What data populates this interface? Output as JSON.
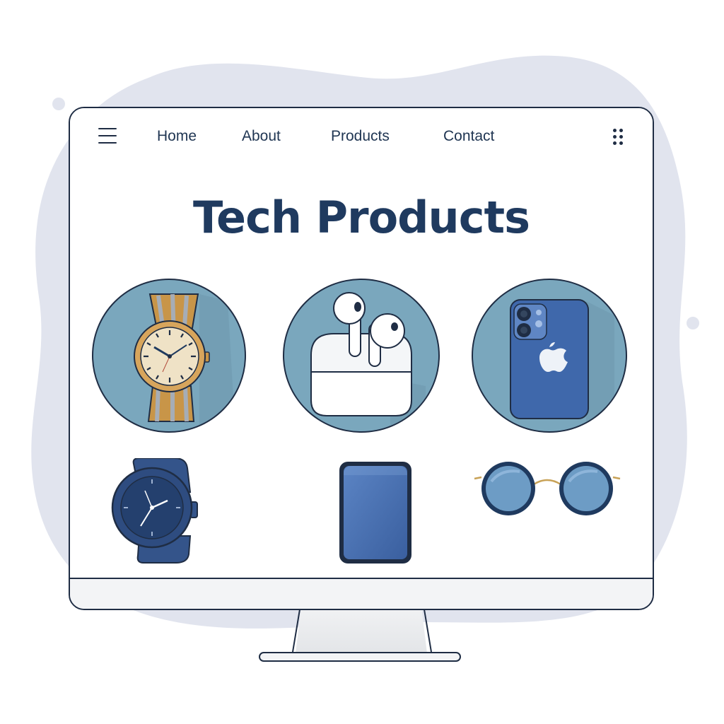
{
  "nav": {
    "menu_icon": "hamburger-menu-icon",
    "links": [
      "Home",
      "About",
      "Products",
      "Contact"
    ],
    "apps_icon": "grid-dots-icon"
  },
  "hero": {
    "title": "Tech Products"
  },
  "products": [
    {
      "icon": "gold-wristwatch-icon"
    },
    {
      "icon": "wireless-earbuds-icon"
    },
    {
      "icon": "smartphone-icon"
    },
    {
      "icon": "smartwatch-icon"
    },
    {
      "icon": "tablet-icon"
    },
    {
      "icon": "sunglasses-icon"
    }
  ],
  "colors": {
    "primary_text": "#1f3a5f",
    "circle_bg": "#7aa7bd",
    "outline": "#1f2d44",
    "product_blue": "#3f68ab",
    "backdrop_blob": "#e1e4ee"
  }
}
